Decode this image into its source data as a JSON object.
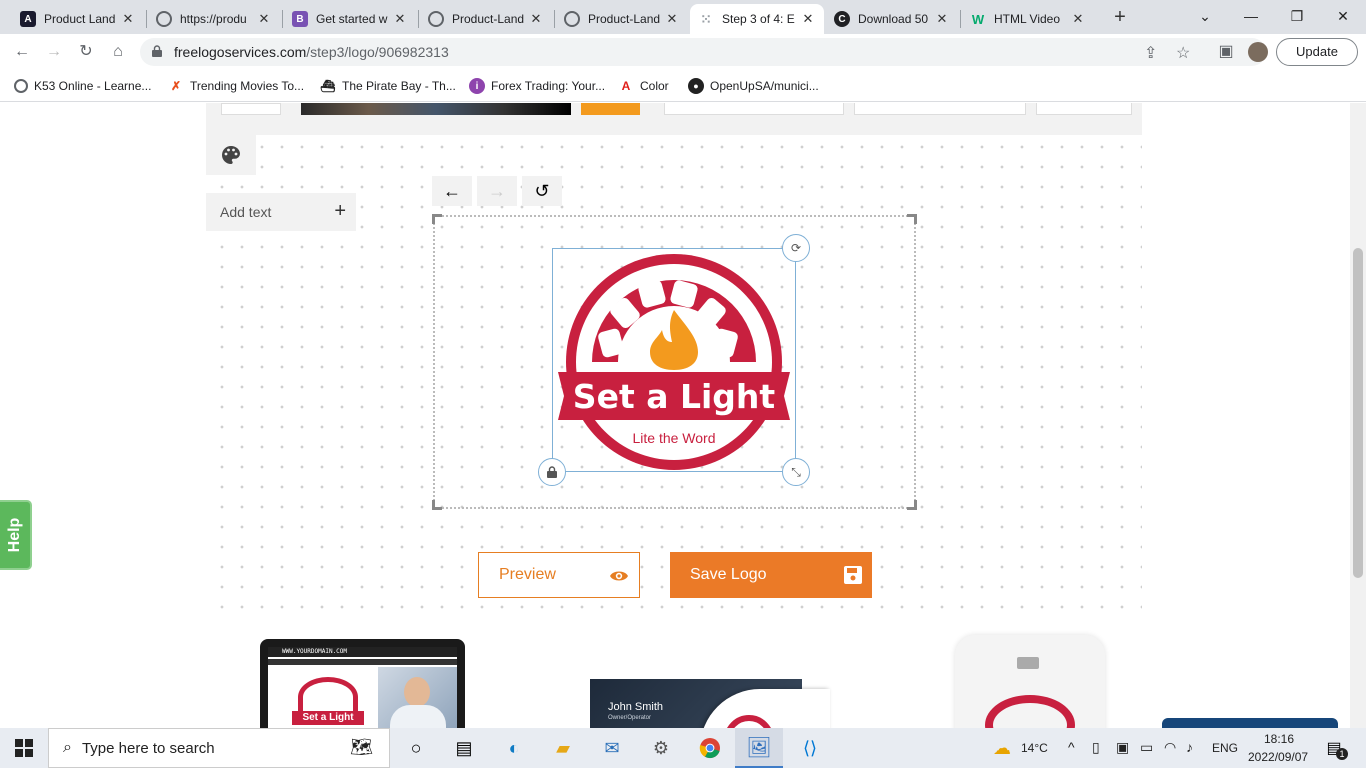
{
  "browser": {
    "tabs": [
      {
        "title": "Product Land",
        "favicon": "A",
        "color": "#1a1a2e"
      },
      {
        "title": "https://produ",
        "favicon": "globe",
        "color": "#5f6368"
      },
      {
        "title": "Get started w",
        "favicon": "B",
        "color": "#7952b3"
      },
      {
        "title": "Product-Land",
        "favicon": "globe",
        "color": "#5f6368"
      },
      {
        "title": "Product-Land",
        "favicon": "globe",
        "color": "#5f6368"
      },
      {
        "title": "Step 3 of 4: E",
        "favicon": "grid",
        "color": "#9aa0a6"
      },
      {
        "title": "Download 50",
        "favicon": "C",
        "color": "#202124"
      },
      {
        "title": "HTML Video",
        "favicon": "W",
        "color": "#04aa6d"
      }
    ],
    "url_domain": "freelogoservices.com",
    "url_path": "/step3/logo/906982313",
    "update_label": "Update",
    "bookmarks": [
      {
        "label": "K53 Online - Learne...",
        "icon": "globe-icon"
      },
      {
        "label": "Trending Movies To...",
        "icon": "x-icon"
      },
      {
        "label": "The Pirate Bay - Th...",
        "icon": "ship-icon"
      },
      {
        "label": "Forex Trading: Your...",
        "icon": "forex-icon"
      },
      {
        "label": "Color",
        "icon": "adobe-icon"
      },
      {
        "label": "OpenUpSA/munici...",
        "icon": "github-icon"
      }
    ]
  },
  "editor": {
    "add_text_label": "Add text",
    "logo_title": "Set a Light",
    "logo_tagline": "Lite the Word",
    "preview_label": "Preview",
    "save_label": "Save Logo",
    "help_label": "Help",
    "mockup_name": "John Smith",
    "mockup_role": "Owner/Operator",
    "mockup_domain": "WWW.YOURDOMAIN.COM",
    "brand_color": "#c8203f",
    "accent_color": "#eb7a27",
    "flame_color": "#f39a1e"
  },
  "taskbar": {
    "search_placeholder": "Type here to search",
    "temperature": "14°C",
    "language": "ENG",
    "time": "18:16",
    "date": "2022/09/07",
    "notification_count": "1"
  }
}
